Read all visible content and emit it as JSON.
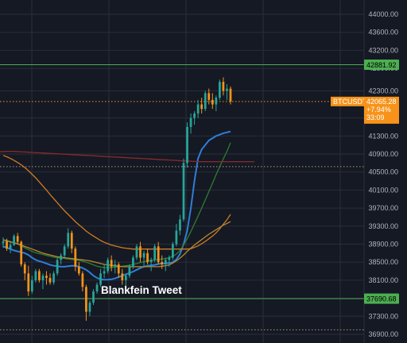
{
  "chart_data": {
    "type": "candlestick",
    "symbol": "BTCUSDT",
    "ylim": [
      36800,
      44200
    ],
    "y_ticks": [
      "44000.00",
      "43600.00",
      "43200.00",
      "42800.00",
      "42300.00",
      "41700.00",
      "41300.00",
      "40900.00",
      "40500.00",
      "40100.00",
      "39700.00",
      "39300.00",
      "38900.00",
      "38500.00",
      "38100.00",
      "37700.00",
      "37300.00",
      "36900.00"
    ],
    "y_tick_values": [
      44000,
      43600,
      43200,
      42800,
      42300,
      41700,
      41300,
      40900,
      40500,
      40100,
      39700,
      39300,
      38900,
      38500,
      38100,
      37700,
      37300,
      36900
    ],
    "price_label": {
      "symbol": "BTCUSDT",
      "price": "42065.28",
      "change": "+7.94%",
      "countdown": "33:09",
      "value": 42065.28,
      "color": "#f7931a"
    },
    "levels": [
      {
        "name": "resistance",
        "value": 42881.92,
        "label": "42881.92",
        "color": "#4caf50",
        "style": "solid"
      },
      {
        "name": "support",
        "value": 37690.68,
        "label": "37690.68",
        "color": "#4caf50",
        "style": "solid"
      },
      {
        "name": "dotted-level-upper",
        "value": 40620,
        "color": "#a59a7a",
        "style": "dotted"
      },
      {
        "name": "dotted-level-lower",
        "value": 37000,
        "color": "#a59a7a",
        "style": "dotted"
      }
    ],
    "annotation": "Blankfein Tweet",
    "candles": [
      [
        38920,
        39050,
        38820,
        38960
      ],
      [
        38960,
        39020,
        38750,
        38800
      ],
      [
        38800,
        38950,
        38700,
        38880
      ],
      [
        38880,
        39120,
        38860,
        39080
      ],
      [
        39080,
        39150,
        38900,
        38950
      ],
      [
        38950,
        38980,
        38400,
        38450
      ],
      [
        38450,
        38500,
        38100,
        38250
      ],
      [
        38250,
        38420,
        37750,
        37850
      ],
      [
        37850,
        38200,
        37800,
        38100
      ],
      [
        38100,
        38350,
        38050,
        38300
      ],
      [
        38300,
        38350,
        38050,
        38100
      ],
      [
        38100,
        38250,
        37900,
        38200
      ],
      [
        38200,
        38300,
        38000,
        38150
      ],
      [
        38150,
        38250,
        38000,
        38050
      ],
      [
        38050,
        38300,
        38000,
        38250
      ],
      [
        38250,
        38600,
        38200,
        38550
      ],
      [
        38550,
        38700,
        38450,
        38650
      ],
      [
        38650,
        38900,
        38600,
        38850
      ],
      [
        38850,
        39250,
        38800,
        39150
      ],
      [
        39150,
        39200,
        38700,
        38800
      ],
      [
        38800,
        38850,
        38300,
        38400
      ],
      [
        38400,
        38500,
        38200,
        38250
      ],
      [
        38250,
        38300,
        37850,
        37950
      ],
      [
        37950,
        38000,
        37200,
        37400
      ],
      [
        37400,
        37650,
        37300,
        37600
      ],
      [
        37600,
        37900,
        37550,
        37850
      ],
      [
        37850,
        38050,
        37800,
        38000
      ],
      [
        38000,
        38350,
        37950,
        38250
      ],
      [
        38250,
        38450,
        38150,
        38300
      ],
      [
        38300,
        38600,
        38250,
        38550
      ],
      [
        38550,
        38650,
        38300,
        38400
      ],
      [
        38400,
        38550,
        38250,
        38450
      ],
      [
        38450,
        38500,
        38150,
        38250
      ],
      [
        38250,
        38350,
        38000,
        38100
      ],
      [
        38100,
        38250,
        37950,
        38200
      ],
      [
        38200,
        38450,
        38150,
        38400
      ],
      [
        38400,
        38650,
        38350,
        38600
      ],
      [
        38600,
        38900,
        38550,
        38850
      ],
      [
        38850,
        38950,
        38500,
        38600
      ],
      [
        38600,
        38750,
        38400,
        38700
      ],
      [
        38700,
        38800,
        38450,
        38500
      ],
      [
        38500,
        38600,
        38300,
        38550
      ],
      [
        38550,
        38900,
        38500,
        38850
      ],
      [
        38850,
        38950,
        38450,
        38500
      ],
      [
        38500,
        38650,
        38350,
        38450
      ],
      [
        38450,
        38600,
        38300,
        38550
      ],
      [
        38550,
        38650,
        38400,
        38600
      ],
      [
        38600,
        38950,
        38550,
        38900
      ],
      [
        38900,
        39350,
        38850,
        39200
      ],
      [
        39200,
        39550,
        39100,
        39450
      ],
      [
        39450,
        40800,
        39400,
        40700
      ],
      [
        40700,
        41600,
        40600,
        41500
      ],
      [
        41500,
        41800,
        41350,
        41700
      ],
      [
        41700,
        41850,
        41550,
        41800
      ],
      [
        41800,
        42100,
        41700,
        42000
      ],
      [
        42000,
        42150,
        41800,
        41900
      ],
      [
        41900,
        42300,
        41850,
        42250
      ],
      [
        42250,
        42350,
        42000,
        42100
      ],
      [
        42100,
        42250,
        41900,
        42000
      ],
      [
        42000,
        42200,
        41850,
        42150
      ],
      [
        42150,
        42550,
        42100,
        42500
      ],
      [
        42500,
        42600,
        42200,
        42300
      ],
      [
        42300,
        42450,
        42100,
        42350
      ],
      [
        42350,
        42400,
        42000,
        42065.28
      ]
    ],
    "moving_averages": [
      {
        "name": "ma-blue",
        "color": "#2e7ed8",
        "values": [
          38850,
          38820,
          38790,
          38760,
          38740,
          38720,
          38700,
          38660,
          38600,
          38550,
          38520,
          38500,
          38470,
          38440,
          38420,
          38410,
          38400,
          38400,
          38410,
          38420,
          38420,
          38400,
          38370,
          38330,
          38270,
          38200,
          38150,
          38120,
          38110,
          38110,
          38120,
          38140,
          38170,
          38200,
          38230,
          38260,
          38290,
          38330,
          38370,
          38400,
          38420,
          38430,
          38440,
          38460,
          38470,
          38470,
          38480,
          38500,
          38560,
          38680,
          38900,
          39200,
          39700,
          40300,
          40800,
          41000,
          41100,
          41200,
          41250,
          41300,
          41330,
          41360,
          41380,
          41400
        ]
      },
      {
        "name": "ma-green",
        "color": "#2e7d32",
        "values": [
          39000,
          38980,
          38960,
          38930,
          38900,
          38860,
          38820,
          38780,
          38740,
          38710,
          38690,
          38670,
          38650,
          38630,
          38610,
          38600,
          38590,
          38580,
          38570,
          38560,
          38550,
          38540,
          38520,
          38500,
          38470,
          38440,
          38410,
          38390,
          38380,
          38380,
          38380,
          38390,
          38400,
          38410,
          38420,
          38430,
          38450,
          38470,
          38490,
          38510,
          38530,
          38540,
          38550,
          38560,
          38570,
          38580,
          38600,
          38630,
          38680,
          38760,
          38880,
          39020,
          39180,
          39350,
          39520,
          39700,
          39880,
          40070,
          40250,
          40440,
          40620,
          40790,
          40960,
          41150
        ]
      },
      {
        "name": "ma-orange-long",
        "color": "#d17b22",
        "values": [
          40870,
          40840,
          40800,
          40760,
          40710,
          40660,
          40600,
          40530,
          40450,
          40370,
          40280,
          40190,
          40100,
          40000,
          39910,
          39820,
          39730,
          39640,
          39560,
          39480,
          39400,
          39330,
          39260,
          39190,
          39130,
          39080,
          39030,
          38980,
          38940,
          38910,
          38880,
          38860,
          38840,
          38820,
          38810,
          38800,
          38790,
          38790,
          38790,
          38790,
          38790,
          38790,
          38790,
          38790,
          38790,
          38790,
          38790,
          38790,
          38790,
          38790,
          38790,
          38790,
          38800,
          38830,
          38860,
          38910,
          38960,
          39020,
          39080,
          39150,
          39240,
          39340,
          39440,
          39560
        ]
      },
      {
        "name": "ma-orange-short",
        "color": "#b8892e",
        "values": [
          38990,
          38970,
          38950,
          38930,
          38910,
          38880,
          38850,
          38820,
          38790,
          38760,
          38730,
          38700,
          38680,
          38660,
          38640,
          38620,
          38610,
          38600,
          38590,
          38580,
          38570,
          38560,
          38550,
          38540,
          38530,
          38510,
          38490,
          38470,
          38450,
          38440,
          38430,
          38420,
          38410,
          38400,
          38400,
          38400,
          38400,
          38400,
          38400,
          38400,
          38400,
          38400,
          38400,
          38400,
          38410,
          38420,
          38440,
          38480,
          38530,
          38590,
          38660,
          38740,
          38810,
          38880,
          38940,
          39000,
          39060,
          39120,
          39170,
          39220,
          39270,
          39320,
          39360,
          39400
        ]
      },
      {
        "name": "ma-red",
        "color": "#8b2a2a",
        "values": [
          40950,
          40955,
          40960,
          40960,
          40955,
          40950,
          40945,
          40940,
          40935,
          40930,
          40925,
          40920,
          40915,
          40910,
          40905,
          40900,
          40895,
          40890,
          40885,
          40880,
          40875,
          40870,
          40865,
          40860,
          40855,
          40850,
          40845,
          40840,
          40835,
          40830,
          40825,
          40820,
          40815,
          40810,
          40805,
          40800,
          40795,
          40790,
          40785,
          40780,
          40775,
          40770,
          40765,
          40760,
          40755,
          40750,
          40745,
          40740,
          40735,
          40730,
          40730,
          40730,
          40730,
          40730,
          40730,
          40730,
          40730,
          40730,
          40730,
          40730,
          40730,
          40730,
          40730,
          40730
        ]
      }
    ],
    "colors": {
      "up": "#26a69a",
      "down": "#f7931a",
      "grid": "#2a2e39",
      "background": "#151924"
    }
  }
}
